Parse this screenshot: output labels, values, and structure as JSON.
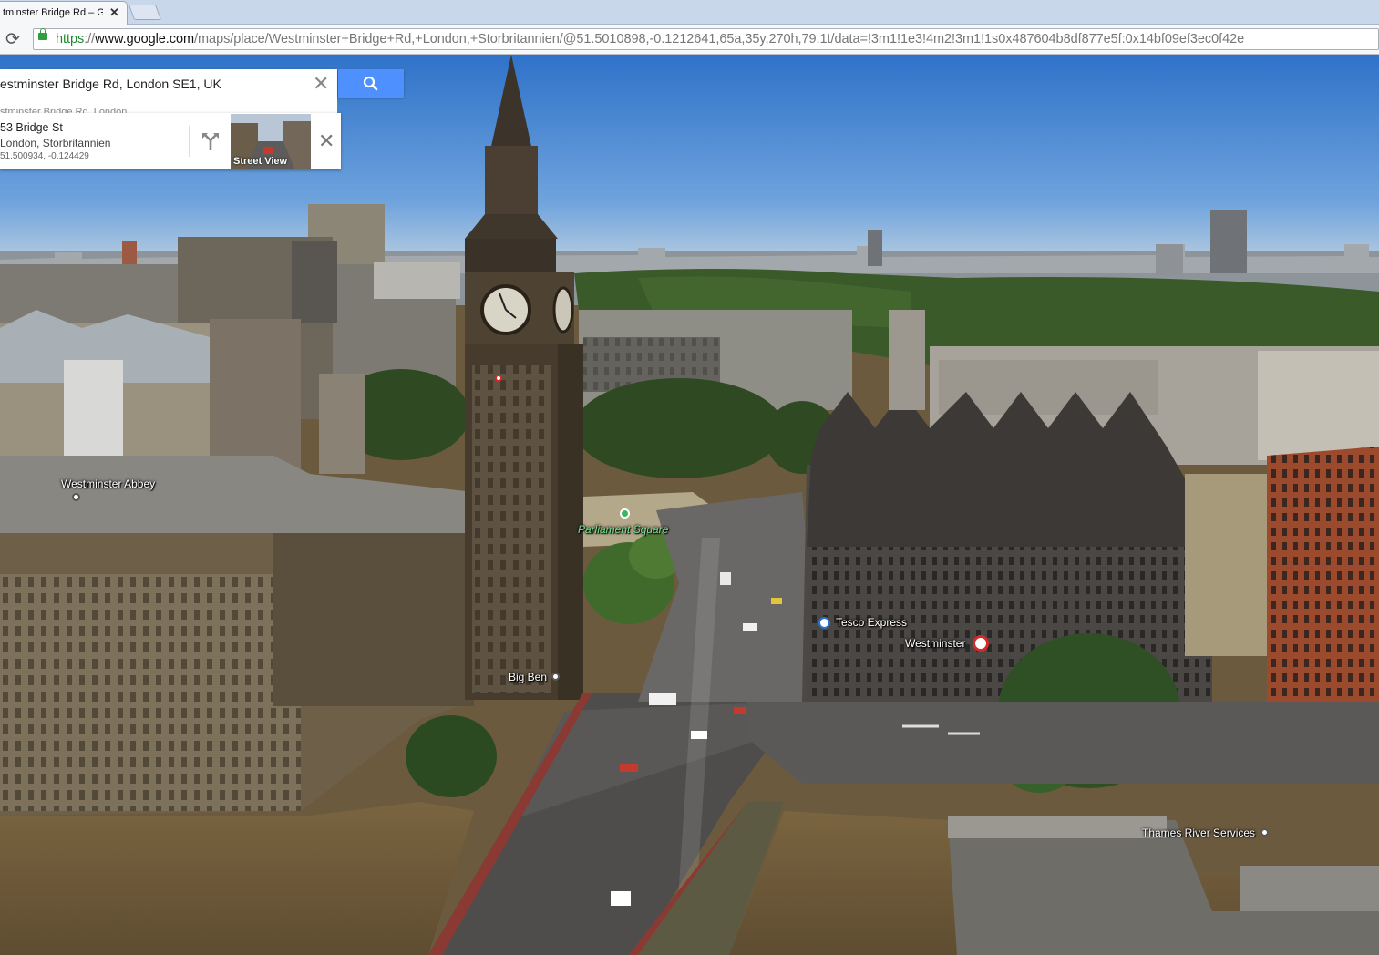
{
  "browser": {
    "tab_title": "tminster Bridge Rd – G",
    "tab_close": "✕",
    "reload_icon": "⟳",
    "url_scheme": "https",
    "url_sep": "://",
    "url_host": "www.google.com",
    "url_path": "/maps/place/Westminster+Bridge+Rd,+London,+Storbritannien/@51.5010898,-0.1212641,65a,35y,270h,79.1t/data=!3m1!1e3!4m2!3m1!1s0x487604b8df877e5f:0x14bf09ef3ec0f42e"
  },
  "search": {
    "query": "estminster Bridge Rd, London SE1, UK",
    "clear_icon": "✕",
    "suggestion": "stminster Bridge Rd, London"
  },
  "place_card": {
    "name": "53 Bridge St",
    "city": "London, Storbritannien",
    "coords": "51.500934, -0.124429",
    "streetview_label": "Street View",
    "close_icon": "✕"
  },
  "map_labels": {
    "westminster_abbey": "Westminster Abbey",
    "parliament_square": "Parliament Square",
    "tesco_express": "Tesco Express",
    "westminster": "Westminster",
    "big_ben": "Big Ben",
    "thames_river_services": "Thames River Services"
  },
  "colors": {
    "accent": "#4d90fe",
    "url_scheme": "#1b8a2e",
    "label_park": "#7be08f"
  }
}
